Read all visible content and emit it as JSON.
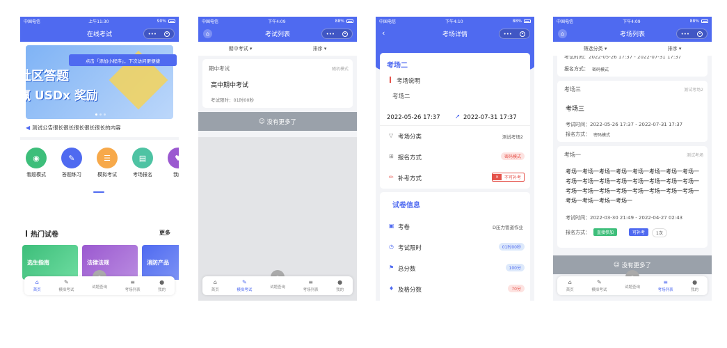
{
  "status_bars": [
    {
      "carrier": "中国电信",
      "time": "上午11:30",
      "battery": "90%"
    },
    {
      "carrier": "中国电信",
      "time": "下午4:09",
      "battery": "88%"
    },
    {
      "carrier": "中国电信",
      "time": "下午4:10",
      "battery": "88%"
    },
    {
      "carrier": "中国电信",
      "time": "下午4:09",
      "battery": "88%"
    }
  ],
  "tab_labels": [
    "首页",
    "模拟考试",
    "试题查询",
    "考场列表",
    "我的"
  ],
  "colors": {
    "primary": "#4F6AF0",
    "gray_bar": "#9aa1aa",
    "green": "#3DBE7A",
    "red": "#E5534B"
  },
  "s1": {
    "title": "在线考试",
    "banner_tip": "点击「添加小程序」，下次访问更便捷",
    "banner_line1": "社区答题",
    "banner_line2": "赢 USDx 奖励",
    "notice": "测试公告很长很长很长很长很长的内容",
    "grid": [
      {
        "label": "看题模式",
        "icon": "eye-icon",
        "color": "#3DBE7A"
      },
      {
        "label": "答题练习",
        "icon": "edit-icon",
        "color": "#4F6AF0"
      },
      {
        "label": "模拟考试",
        "icon": "note-icon",
        "color": "#F7A94A"
      },
      {
        "label": "考场报名",
        "icon": "chart-icon",
        "color": "#4EC3A3"
      },
      {
        "label": "我的",
        "icon": "heart-icon",
        "color": "#9B59D0"
      }
    ],
    "hot_title": "热门试卷",
    "hot_more": "更多",
    "papers": [
      "选生指南",
      "法律法规",
      "消防产品"
    ]
  },
  "s2": {
    "title": "考试列表",
    "filter1": "期中考试",
    "filter2": "排序",
    "card": {
      "category": "期中考试",
      "mode": "随机模式",
      "name": "高中期中考试",
      "limit": "考试限时：01时00秒"
    },
    "no_more": "没有更多了"
  },
  "s3": {
    "title": "考场详情",
    "hall": "考场二",
    "desc_label": "考场说明",
    "desc_value": "考场二",
    "start": "2022-05-26 17:37",
    "end": "2022-07-31 17:37",
    "rows": [
      {
        "label": "考场分类",
        "value": "测试考场2"
      },
      {
        "label": "报名方式",
        "value": "密码模式"
      },
      {
        "label": "补考方式",
        "value": "不可补考"
      }
    ],
    "paper_title": "试卷信息",
    "paper_rows": [
      {
        "label": "考卷",
        "value": "D压力管道作业"
      },
      {
        "label": "考试限时",
        "value": "01时00秒"
      },
      {
        "label": "总分数",
        "value": "100分"
      },
      {
        "label": "及格分数",
        "value": "70分"
      }
    ]
  },
  "s4": {
    "title": "考场列表",
    "filter1": "筛选分类",
    "filter2": "排序",
    "top_time": "考试时间：2022-05-26 17:37 - 2022-07-31 17:37",
    "top_signup_label": "报名方式：",
    "top_signup": "密码模式",
    "card2": {
      "head": "考场三",
      "tag": "测试考场2",
      "name": "考场三",
      "time": "考试时间：2022-05-26 17:37 - 2022-07-31 17:37",
      "signup_label": "报名方式：",
      "signup": "密码模式"
    },
    "card3": {
      "head": "考场一",
      "tag": "测试考场",
      "long_name": "考场一考场一考场一考场一考场一考场一考场一考场一考场一考场一考场一考场一考场一考场一考场一考场一考场一考场一考场一考场一考场一考场一考场一考场一考场一考场一考场一考场一",
      "time": "考试时间：2022-03-30 21:49 - 2022-04-27 02:43",
      "signup_label": "报名方式：",
      "signup": "直接参加",
      "retake": "可补考",
      "count": "1次"
    },
    "no_more": "没有更多了"
  }
}
